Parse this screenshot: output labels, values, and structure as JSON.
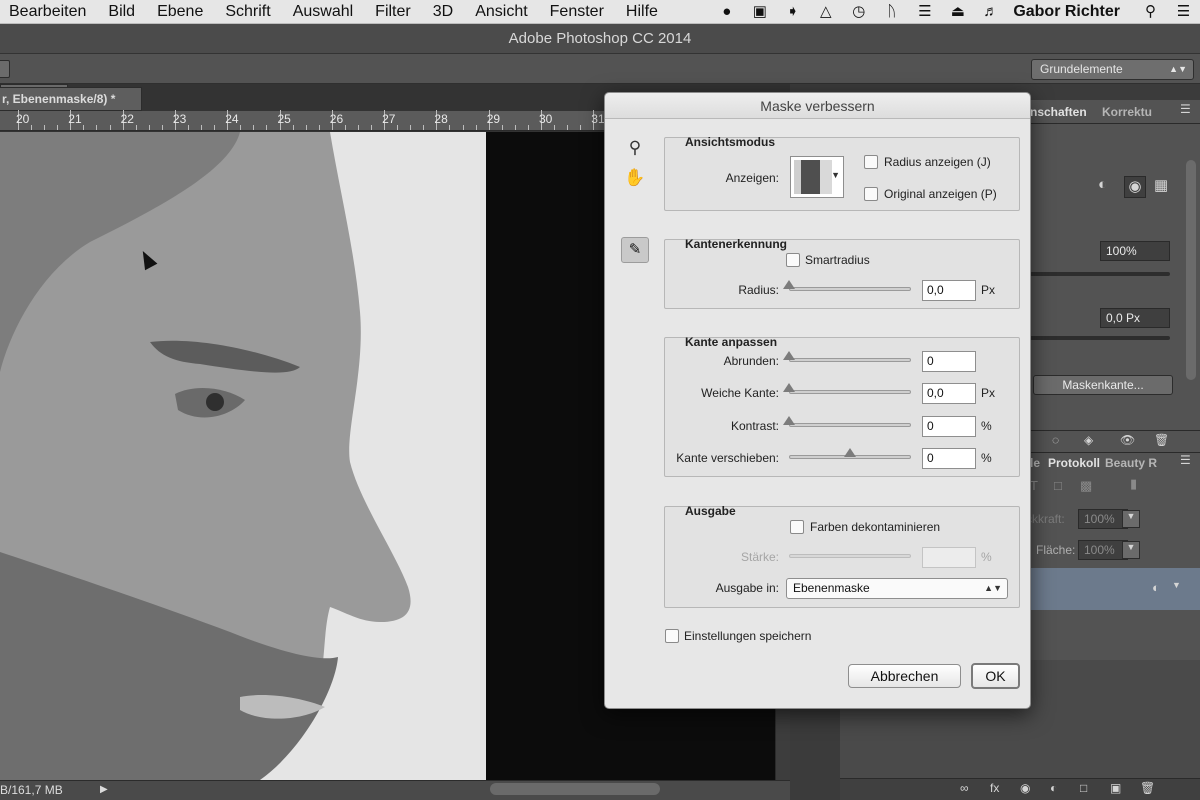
{
  "menubar": {
    "items": [
      "Bearbeiten",
      "Bild",
      "Ebene",
      "Schrift",
      "Auswahl",
      "Filter",
      "3D",
      "Ansicht",
      "Fenster",
      "Hilfe"
    ],
    "user": "Gabor Richter",
    "status_icons": [
      "hat-icon",
      "screen-mirror-icon",
      "forward-icon",
      "airplay-icon",
      "clock-icon",
      "bluetooth-icon",
      "wifi-icon",
      "eject-icon",
      "volume-icon"
    ]
  },
  "app": {
    "title": "Adobe Photoshop CC 2014",
    "workspace": "Grundelemente"
  },
  "document": {
    "tab_label": "r, Ebenenmaske/8) *",
    "ruler_numbers": [
      "20",
      "21",
      "22",
      "23",
      "24",
      "25",
      "26",
      "27",
      "28",
      "29",
      "30",
      "31"
    ],
    "status_text": "B/161,7 MB"
  },
  "panels": {
    "tab_properties": "nschaften",
    "tab_corrections": "Korrektu",
    "density_value": "100%",
    "feather_value": "0,0 Px",
    "mask_edge_button": "Maskenkante...",
    "tab_protocol": "Protokoll",
    "tab_beauty": "Beauty R",
    "tab_prefix": "le",
    "opacity_label": "ckkraft:",
    "opacity_value": "100%",
    "fill_label": "Fläche:",
    "fill_value": "100%"
  },
  "dialog": {
    "title": "Maske verbessern",
    "view_mode": {
      "title": "Ansichtsmodus",
      "show_label": "Anzeigen:",
      "show_radius": "Radius anzeigen (J)",
      "show_original": "Original anzeigen (P)"
    },
    "edge_detection": {
      "title": "Kantenerkennung",
      "smart_radius": "Smartradius",
      "radius_label": "Radius:",
      "radius_value": "0,0",
      "radius_unit": "Px"
    },
    "adjust_edge": {
      "title": "Kante anpassen",
      "smooth_label": "Abrunden:",
      "smooth_value": "0",
      "feather_label": "Weiche Kante:",
      "feather_value": "0,0",
      "feather_unit": "Px",
      "contrast_label": "Kontrast:",
      "contrast_value": "0",
      "contrast_unit": "%",
      "shift_label": "Kante verschieben:",
      "shift_value": "0",
      "shift_unit": "%"
    },
    "output": {
      "title": "Ausgabe",
      "decontaminate": "Farben dekontaminieren",
      "amount_label": "Stärke:",
      "amount_unit": "%",
      "output_to_label": "Ausgabe in:",
      "output_to_value": "Ebenenmaske"
    },
    "remember_settings": "Einstellungen speichern",
    "cancel": "Abbrechen",
    "ok": "OK"
  }
}
